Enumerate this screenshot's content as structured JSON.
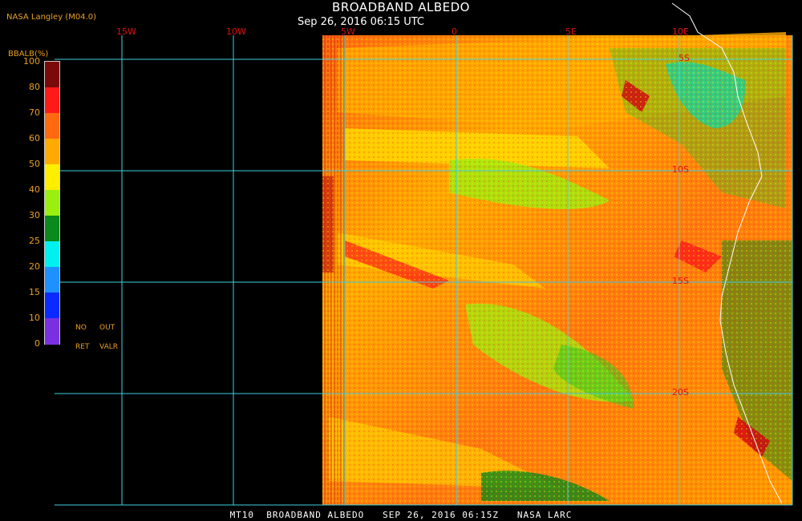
{
  "header": {
    "agency": "NASA Langley (M04.0)",
    "title": "BROADBAND ALBEDO",
    "datetime": "Sep 26, 2016 06:15 UTC"
  },
  "colorbar": {
    "title": "BBALB(%)",
    "ticks": [
      "100",
      "80",
      "70",
      "60",
      "50",
      "40",
      "30",
      "25",
      "20",
      "15",
      "10",
      "0"
    ],
    "colors": [
      "#7a0a0a",
      "#ff1a1a",
      "#ff6a10",
      "#ffaa00",
      "#ffee00",
      "#9aef10",
      "#0a8a1a",
      "#00f0f0",
      "#1e90ff",
      "#0a2aff",
      "#7a30e0"
    ],
    "no_ret_labels": [
      "NO",
      "OUT",
      "RET",
      "VALR"
    ]
  },
  "grid": {
    "lon_labels": [
      "15W",
      "10W",
      "5W",
      "0",
      "5E",
      "10E"
    ],
    "lat_labels": [
      "5S",
      "10S",
      "15S",
      "20S"
    ],
    "line_color": "#40d0e0"
  },
  "footer": {
    "text": "MT10  BROADBAND ALBEDO   SEP 26, 2016 06:15Z   NASA LARC"
  }
}
